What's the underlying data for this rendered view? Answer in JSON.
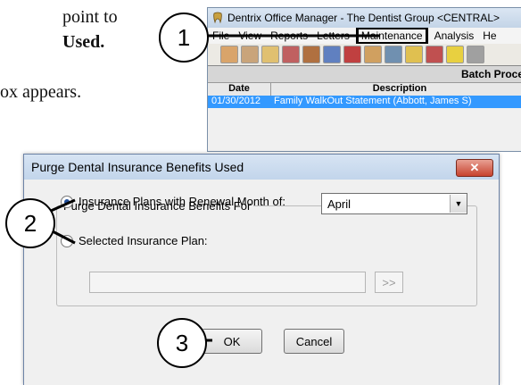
{
  "doc": {
    "line1": "point to",
    "line2": "Used.",
    "line3": "ox appears."
  },
  "app": {
    "title": "Dentrix Office Manager - The Dentist Group <CENTRAL>",
    "menu": [
      "File",
      "View",
      "Reports",
      "Letters",
      "Maintenance",
      "Analysis",
      "He"
    ],
    "active_menu": "Maintenance",
    "batch_header": "Batch Proce",
    "columns": [
      "Date",
      "Description"
    ],
    "row": {
      "date": "01/30/2012",
      "description": "Family WalkOut Statement (Abbott, James S)"
    }
  },
  "dialog": {
    "title": "Purge Dental Insurance Benefits Used",
    "close_label": "✕",
    "group_label": "Purge Dental Insurance Benefits For",
    "option1_label": "Insurance Plans with Renewal Month of:",
    "month_value": "April",
    "option2_label": "Selected Insurance Plan:",
    "plan_value": "",
    "browse_label": ">>",
    "ok_label": "OK",
    "cancel_label": "Cancel"
  },
  "callouts": {
    "c1": "1",
    "c2": "2",
    "c3": "3"
  }
}
